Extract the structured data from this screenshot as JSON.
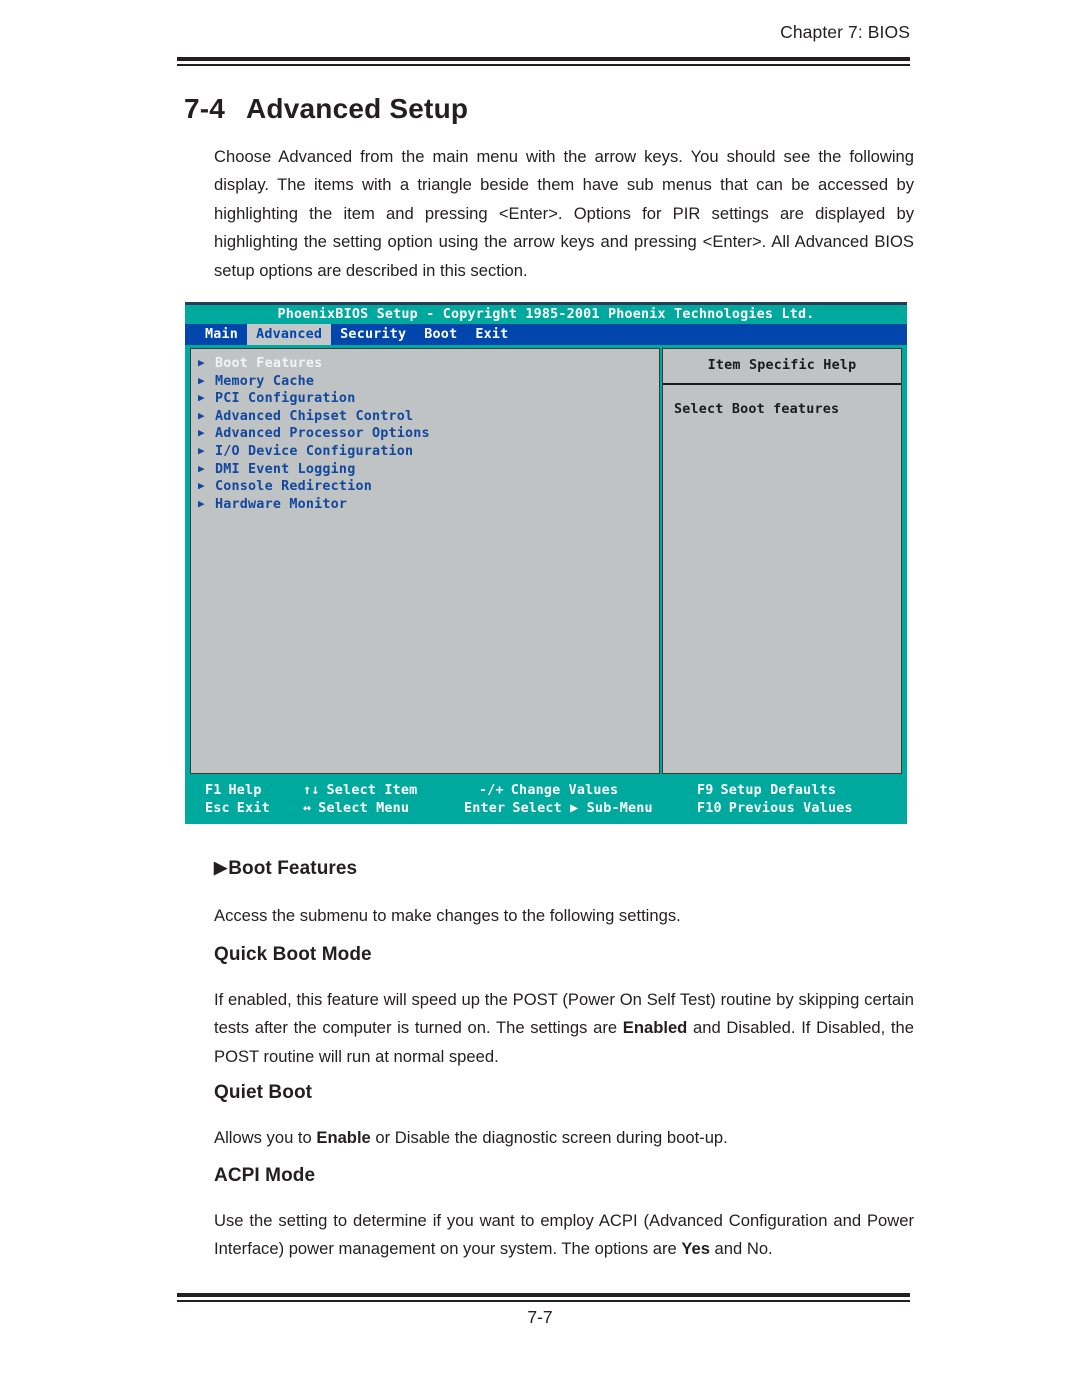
{
  "header": {
    "running_head": "Chapter 7: BIOS"
  },
  "section": {
    "number": "7-4",
    "title": "Advanced Setup"
  },
  "intro_paragraph": "Choose Advanced from the main menu with the arrow keys.   You should see the following display.  The items with a triangle beside them have sub menus that can be accessed by highlighting the item and pressing <Enter>. Options for PIR settings are displayed by highlighting the setting option using the arrow keys and pressing <Enter>.  All Advanced BIOS setup options are described in this section.",
  "bios": {
    "title_bar": "PhoenixBIOS Setup - Copyright 1985-2001 Phoenix Technologies Ltd.",
    "tabs": [
      {
        "label": "Main",
        "active": false
      },
      {
        "label": "Advanced",
        "active": true
      },
      {
        "label": "Security",
        "active": false
      },
      {
        "label": "Boot",
        "active": false
      },
      {
        "label": "Exit",
        "active": false
      }
    ],
    "menu_items": [
      {
        "label": "Boot Features",
        "selected": true
      },
      {
        "label": "Memory Cache",
        "selected": false
      },
      {
        "label": "PCI Configuration",
        "selected": false
      },
      {
        "label": "Advanced Chipset Control",
        "selected": false
      },
      {
        "label": "Advanced Processor Options",
        "selected": false
      },
      {
        "label": "I/O Device Configuration",
        "selected": false
      },
      {
        "label": "DMI Event Logging",
        "selected": false
      },
      {
        "label": "Console Redirection",
        "selected": false
      },
      {
        "label": "Hardware Monitor",
        "selected": false
      }
    ],
    "help": {
      "title": "Item Specific Help",
      "text": "Select Boot features"
    },
    "footer": {
      "row1": [
        {
          "key": "F1",
          "action": "Help"
        },
        {
          "key": "↑↓",
          "action": "Select Item"
        },
        {
          "key": "-/+",
          "action": "Change Values"
        },
        {
          "key": "F9",
          "action": "Setup Defaults"
        }
      ],
      "row2": [
        {
          "key": "Esc",
          "action": "Exit"
        },
        {
          "key": "↔",
          "action": "Select Menu"
        },
        {
          "key": "Enter",
          "action": "Select ▶ Sub-Menu"
        },
        {
          "key": "F10",
          "action": "Previous Values"
        }
      ]
    },
    "colors": {
      "teal": "#00a99d",
      "menu_blue": "#0046ad",
      "panel_gray": "#bfc3c4",
      "link_blue": "#11489e"
    }
  },
  "sections": {
    "boot_features": {
      "heading": "Boot Features",
      "heading_marker": "▶",
      "body": "Access the submenu to make changes to the following settings."
    },
    "quick_boot_mode": {
      "heading": "Quick Boot Mode",
      "body_part1": "If enabled, this feature will speed up the POST (Power On Self Test) routine by skipping certain tests after the computer is turned on. The settings are ",
      "body_bold1": "Enabled",
      "body_part2": " and Disabled. If Disabled, the POST routine will run at normal speed."
    },
    "quiet_boot": {
      "heading": "Quiet Boot",
      "body_part1": "Allows you to ",
      "body_bold1": "Enable",
      "body_part2": " or Disable the diagnostic screen during boot-up."
    },
    "acpi_mode": {
      "heading": "ACPI Mode",
      "body_part1": "Use the setting to determine if you want to employ ACPI (Advanced Configuration and Power Interface) power management on your system.  The options are ",
      "body_bold1": "Yes",
      "body_part2": " and No."
    }
  },
  "footer": {
    "page_number": "7-7"
  }
}
